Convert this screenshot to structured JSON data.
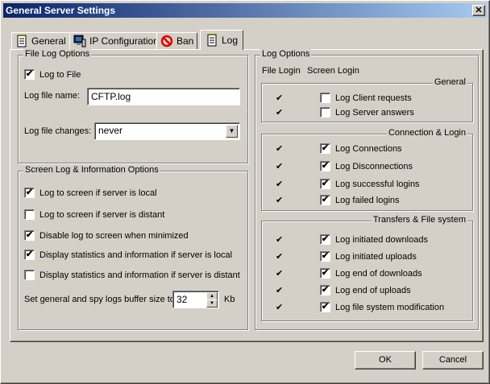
{
  "window": {
    "title": "General Server Settings",
    "close_glyph": "✕"
  },
  "tabs": [
    {
      "label": "General",
      "icon": "notepad-icon"
    },
    {
      "label": "IP Configuration",
      "icon": "network-computer-icon"
    },
    {
      "label": "Ban",
      "icon": "ban-icon"
    },
    {
      "label": "Log",
      "icon": "log-notepad-icon",
      "active": true
    }
  ],
  "file_log": {
    "title": "File Log Options",
    "log_to_file": {
      "label": "Log to File",
      "checked": true
    },
    "file_name_label": "Log file name:",
    "file_name_value": "CFTP.log",
    "changes_label": "Log file changes:",
    "changes_value": "never"
  },
  "screen_log": {
    "title": "Screen Log & Information Options",
    "options": [
      {
        "label": "Log to screen if server is local",
        "checked": true
      },
      {
        "label": "Log to screen if server is distant",
        "checked": false
      },
      {
        "label": "Disable log to screen when minimized",
        "checked": true
      },
      {
        "label": "Display statistics and information if server is local",
        "checked": true
      },
      {
        "label": "Display statistics and information if server is distant",
        "checked": false
      }
    ],
    "buffer_label": "Set general and spy logs buffer size to",
    "buffer_value": "32",
    "buffer_unit": "Kb"
  },
  "log_options": {
    "title": "Log Options",
    "col_file": "File Login",
    "col_screen": "Screen Login",
    "groups": [
      {
        "title": "General",
        "items": [
          {
            "label": "Log Client requests",
            "file": true,
            "screen": false
          },
          {
            "label": "Log Server answers",
            "file": true,
            "screen": false
          }
        ]
      },
      {
        "title": "Connection & Login",
        "items": [
          {
            "label": "Log Connections",
            "file": true,
            "screen": true
          },
          {
            "label": "Log Disconnections",
            "file": true,
            "screen": true
          },
          {
            "label": "Log successful logins",
            "file": true,
            "screen": true
          },
          {
            "label": "Log failed logins",
            "file": true,
            "screen": true
          }
        ]
      },
      {
        "title": "Transfers & File system",
        "items": [
          {
            "label": "Log initiated downloads",
            "file": true,
            "screen": true
          },
          {
            "label": "Log initiated uploads",
            "file": true,
            "screen": true
          },
          {
            "label": "Log end of downloads",
            "file": true,
            "screen": true
          },
          {
            "label": "Log end of uploads",
            "file": true,
            "screen": true
          },
          {
            "label": "Log file system modification",
            "file": true,
            "screen": true
          }
        ]
      }
    ]
  },
  "buttons": {
    "ok": "OK",
    "cancel": "Cancel"
  },
  "check_glyph": "✔"
}
